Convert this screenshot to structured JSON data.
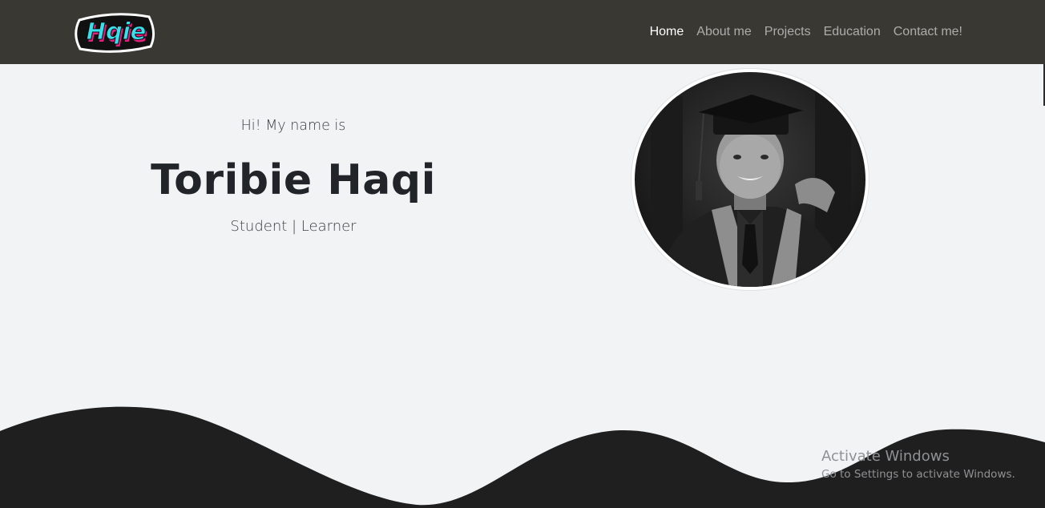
{
  "navbar": {
    "brand": {
      "logo_text": "Hqie",
      "icon": "hqie-logo"
    },
    "links": [
      {
        "label": "Home",
        "active": true
      },
      {
        "label": "About me",
        "active": false
      },
      {
        "label": "Projects",
        "active": false
      },
      {
        "label": "Education",
        "active": false
      },
      {
        "label": "Contact me!",
        "active": false
      }
    ]
  },
  "hero": {
    "greeting": "Hi! My name is",
    "name": "Toribie Haqi",
    "roles": "Student | Learner",
    "photo": {
      "icon": "graduation-portrait",
      "style": "grayscale"
    }
  },
  "watermark": {
    "title": "Activate Windows",
    "subtitle": "Go to Settings to activate Windows."
  },
  "colors": {
    "navbar_bg": "#393833",
    "page_bg": "#f2f3f5",
    "wave": "#1f1f1f",
    "logo_fill": "#38e0ec",
    "logo_shadow": "#e0217e",
    "text_dark": "#212529"
  }
}
